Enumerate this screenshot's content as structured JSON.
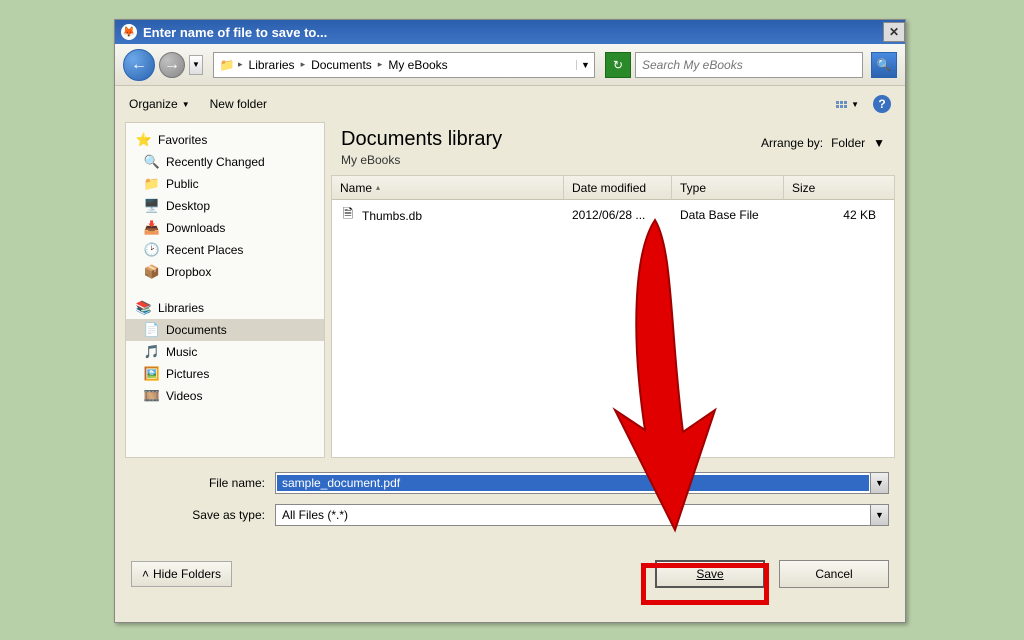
{
  "window": {
    "title": "Enter name of file to save to..."
  },
  "breadcrumb": {
    "seg1": "Libraries",
    "seg2": "Documents",
    "seg3": "My eBooks"
  },
  "search": {
    "placeholder": "Search My eBooks"
  },
  "toolbar": {
    "organize": "Organize",
    "new_folder": "New folder"
  },
  "sidebar": {
    "favorites_hdr": "Favorites",
    "fav": {
      "recently_changed": "Recently Changed",
      "public": "Public",
      "desktop": "Desktop",
      "downloads": "Downloads",
      "recent_places": "Recent Places",
      "dropbox": "Dropbox"
    },
    "libraries_hdr": "Libraries",
    "lib": {
      "documents": "Documents",
      "music": "Music",
      "pictures": "Pictures",
      "videos": "Videos"
    }
  },
  "library": {
    "title": "Documents library",
    "subtitle": "My eBooks",
    "arrange_label": "Arrange by:",
    "arrange_value": "Folder"
  },
  "columns": {
    "name": "Name",
    "date": "Date modified",
    "type": "Type",
    "size": "Size"
  },
  "files": [
    {
      "name": "Thumbs.db",
      "date": "2012/06/28 ...",
      "type": "Data Base File",
      "size": "42 KB"
    }
  ],
  "fields": {
    "filename_label": "File name:",
    "filename_value": "sample_document.pdf",
    "saveastype_label": "Save as type:",
    "saveastype_value": "All Files (*.*)"
  },
  "buttons": {
    "hide_folders": "Hide Folders",
    "save": "Save",
    "cancel": "Cancel"
  },
  "colors": {
    "highlight": "#e00000"
  }
}
